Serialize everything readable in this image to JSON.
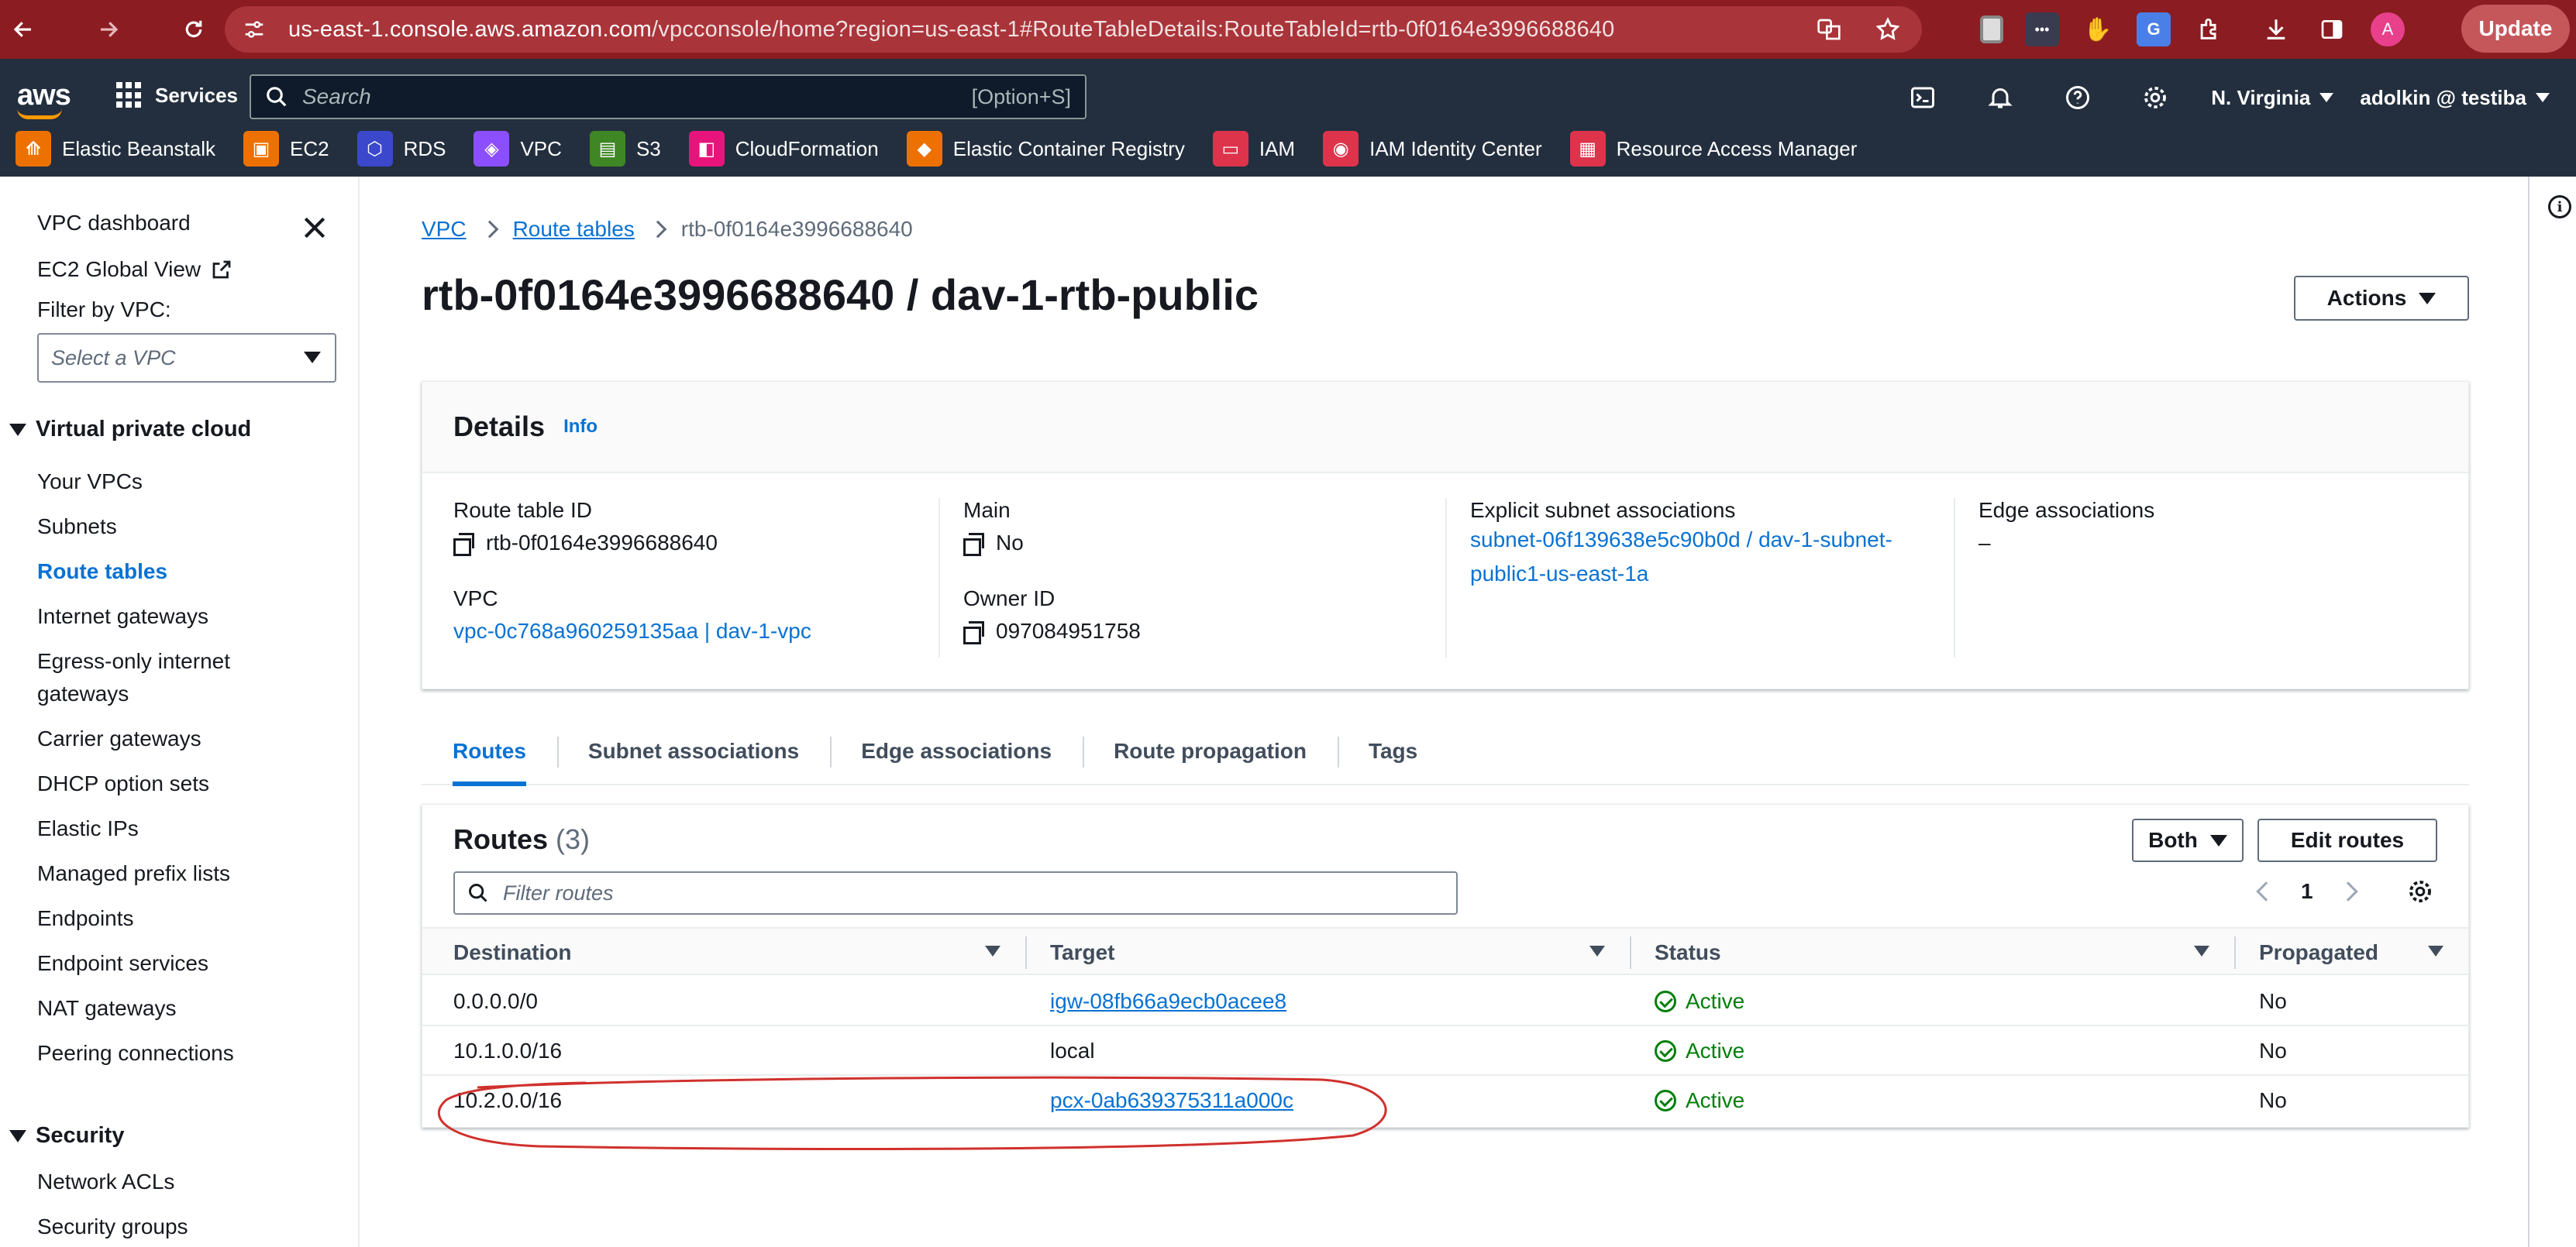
{
  "browser": {
    "url_host": "us-east-1.console.aws.amazon.com",
    "url_path": "/vpcconsole/home?region=us-east-1#RouteTableDetails:RouteTableId=rtb-0f0164e3996688640",
    "profile_initial": "A",
    "update_label": "Update"
  },
  "aws_nav": {
    "logo": "aws",
    "services_label": "Services",
    "search_placeholder": "Search",
    "search_shortcut": "[Option+S]",
    "region": "N. Virginia",
    "account": "adolkin @ testiba"
  },
  "favorites": [
    {
      "label": "Elastic Beanstalk",
      "color": "#ed7100"
    },
    {
      "label": "EC2",
      "color": "#ed7100"
    },
    {
      "label": "RDS",
      "color": "#3b48cc"
    },
    {
      "label": "VPC",
      "color": "#8c4fff"
    },
    {
      "label": "S3",
      "color": "#3f8624"
    },
    {
      "label": "CloudFormation",
      "color": "#e7157b"
    },
    {
      "label": "Elastic Container Registry",
      "color": "#ed7100"
    },
    {
      "label": "IAM",
      "color": "#dd344c"
    },
    {
      "label": "IAM Identity Center",
      "color": "#dd344c"
    },
    {
      "label": "Resource Access Manager",
      "color": "#dd344c"
    }
  ],
  "sidebar": {
    "dashboard": "VPC dashboard",
    "global_view": "EC2 Global View",
    "filter_label": "Filter by VPC:",
    "filter_placeholder": "Select a VPC",
    "section_vpc": "Virtual private cloud",
    "vpc_items": [
      "Your VPCs",
      "Subnets",
      "Route tables",
      "Internet gateways",
      "Egress-only internet",
      "gateways",
      "Carrier gateways",
      "DHCP option sets",
      "Elastic IPs",
      "Managed prefix lists",
      "Endpoints",
      "Endpoint services",
      "NAT gateways",
      "Peering connections"
    ],
    "section_security": "Security",
    "security_items": [
      "Network ACLs",
      "Security groups"
    ]
  },
  "breadcrumb": {
    "vpc": "VPC",
    "route_tables": "Route tables",
    "current": "rtb-0f0164e3996688640"
  },
  "page": {
    "title": "rtb-0f0164e3996688640 / dav-1-rtb-public",
    "actions_label": "Actions"
  },
  "details": {
    "heading": "Details",
    "info": "Info",
    "route_table_id_label": "Route table ID",
    "route_table_id": "rtb-0f0164e3996688640",
    "vpc_label": "VPC",
    "vpc_value": "vpc-0c768a960259135aa | dav-1-vpc",
    "main_label": "Main",
    "main_value": "No",
    "owner_label": "Owner ID",
    "owner_value": "097084951758",
    "explicit_label": "Explicit subnet associations",
    "explicit_line1": "subnet-06f139638e5c90b0d / dav-1-subnet-",
    "explicit_line2": "public1-us-east-1a",
    "edge_label": "Edge associations",
    "edge_value": "–"
  },
  "tabs": [
    "Routes",
    "Subnet associations",
    "Edge associations",
    "Route propagation",
    "Tags"
  ],
  "routes": {
    "title": "Routes",
    "count": "(3)",
    "both_label": "Both",
    "edit_label": "Edit routes",
    "filter_placeholder": "Filter routes",
    "page": "1",
    "columns": [
      "Destination",
      "Target",
      "Status",
      "Propagated"
    ],
    "rows": [
      {
        "destination": "0.0.0.0/0",
        "target": "igw-08fb66a9ecb0acee8",
        "target_link": true,
        "status": "Active",
        "propagated": "No"
      },
      {
        "destination": "10.1.0.0/16",
        "target": "local",
        "target_link": false,
        "status": "Active",
        "propagated": "No"
      },
      {
        "destination": "10.2.0.0/16",
        "target": "pcx-0ab639375311a000c",
        "target_link": true,
        "status": "Active",
        "propagated": "No"
      }
    ]
  },
  "colors": {
    "aws_nav_bg": "#232f3e",
    "link": "#0972d3",
    "status_active": "#037f0c",
    "annotation": "#d0312d",
    "browser_bar": "#8b1c22"
  }
}
